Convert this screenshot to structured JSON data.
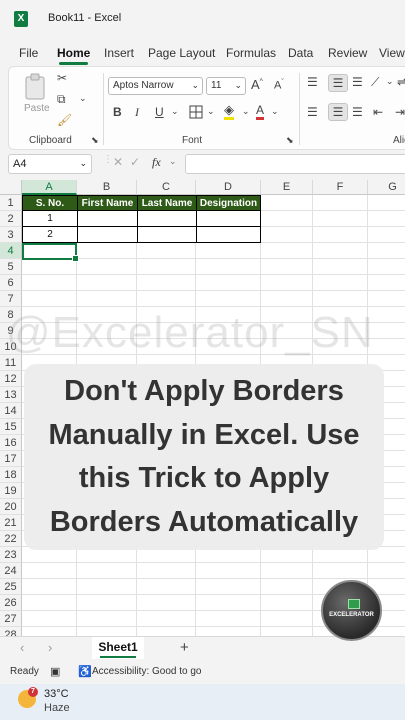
{
  "window": {
    "title": "Book11  -  Excel",
    "app_icon": "excel-logo-icon",
    "app_icon_letter": "X"
  },
  "menu": {
    "items": [
      "File",
      "Home",
      "Insert",
      "Page Layout",
      "Formulas",
      "Data",
      "Review",
      "View"
    ],
    "active": "Home"
  },
  "ribbon": {
    "clipboard": {
      "label": "Clipboard",
      "paste_label": "Paste"
    },
    "font": {
      "label": "Font",
      "font_name": "Aptos Narrow",
      "font_size": "11",
      "grow_font": "A",
      "shrink_font": "A",
      "bold": "B",
      "italic": "I",
      "underline": "U"
    },
    "alignment": {
      "label": "Alig"
    }
  },
  "formula_bar": {
    "name_box": "A4",
    "fx": "fx",
    "value": ""
  },
  "sheet": {
    "columns": [
      "A",
      "B",
      "C",
      "D",
      "E",
      "F",
      "G"
    ],
    "selected_column": "A",
    "rows": [
      "1",
      "2",
      "3",
      "4",
      "5",
      "6",
      "7",
      "8",
      "9",
      "10",
      "11",
      "12",
      "13",
      "14",
      "15",
      "16",
      "17",
      "18",
      "19",
      "20",
      "21",
      "22",
      "23",
      "24",
      "25",
      "26",
      "27",
      "28"
    ],
    "selected_row": "4",
    "table_headers": [
      "S. No.",
      "First Name",
      "Last Name",
      "Designation"
    ],
    "table_rows": [
      [
        "1",
        "",
        "",
        ""
      ],
      [
        "2",
        "",
        "",
        ""
      ]
    ],
    "header_fill": "#2d5a16",
    "active_cell": "A4"
  },
  "overlay": {
    "watermark": "@Excelerator_SN",
    "caption_lines": [
      "Don't Apply Borders",
      "Manually in Excel. Use",
      "this Trick to Apply",
      "Borders Automatically"
    ],
    "badge_text": "EXCELERATOR"
  },
  "sheet_tabs": {
    "tabs": [
      "Sheet1"
    ],
    "add": "+"
  },
  "status": {
    "ready": "Ready",
    "accessibility": "Accessibility: Good to go"
  },
  "taskbar": {
    "temperature": "33°C",
    "condition": "Haze",
    "notification_count": "7"
  },
  "colors": {
    "accent": "#107c41",
    "header_fill": "#2d5a16"
  }
}
